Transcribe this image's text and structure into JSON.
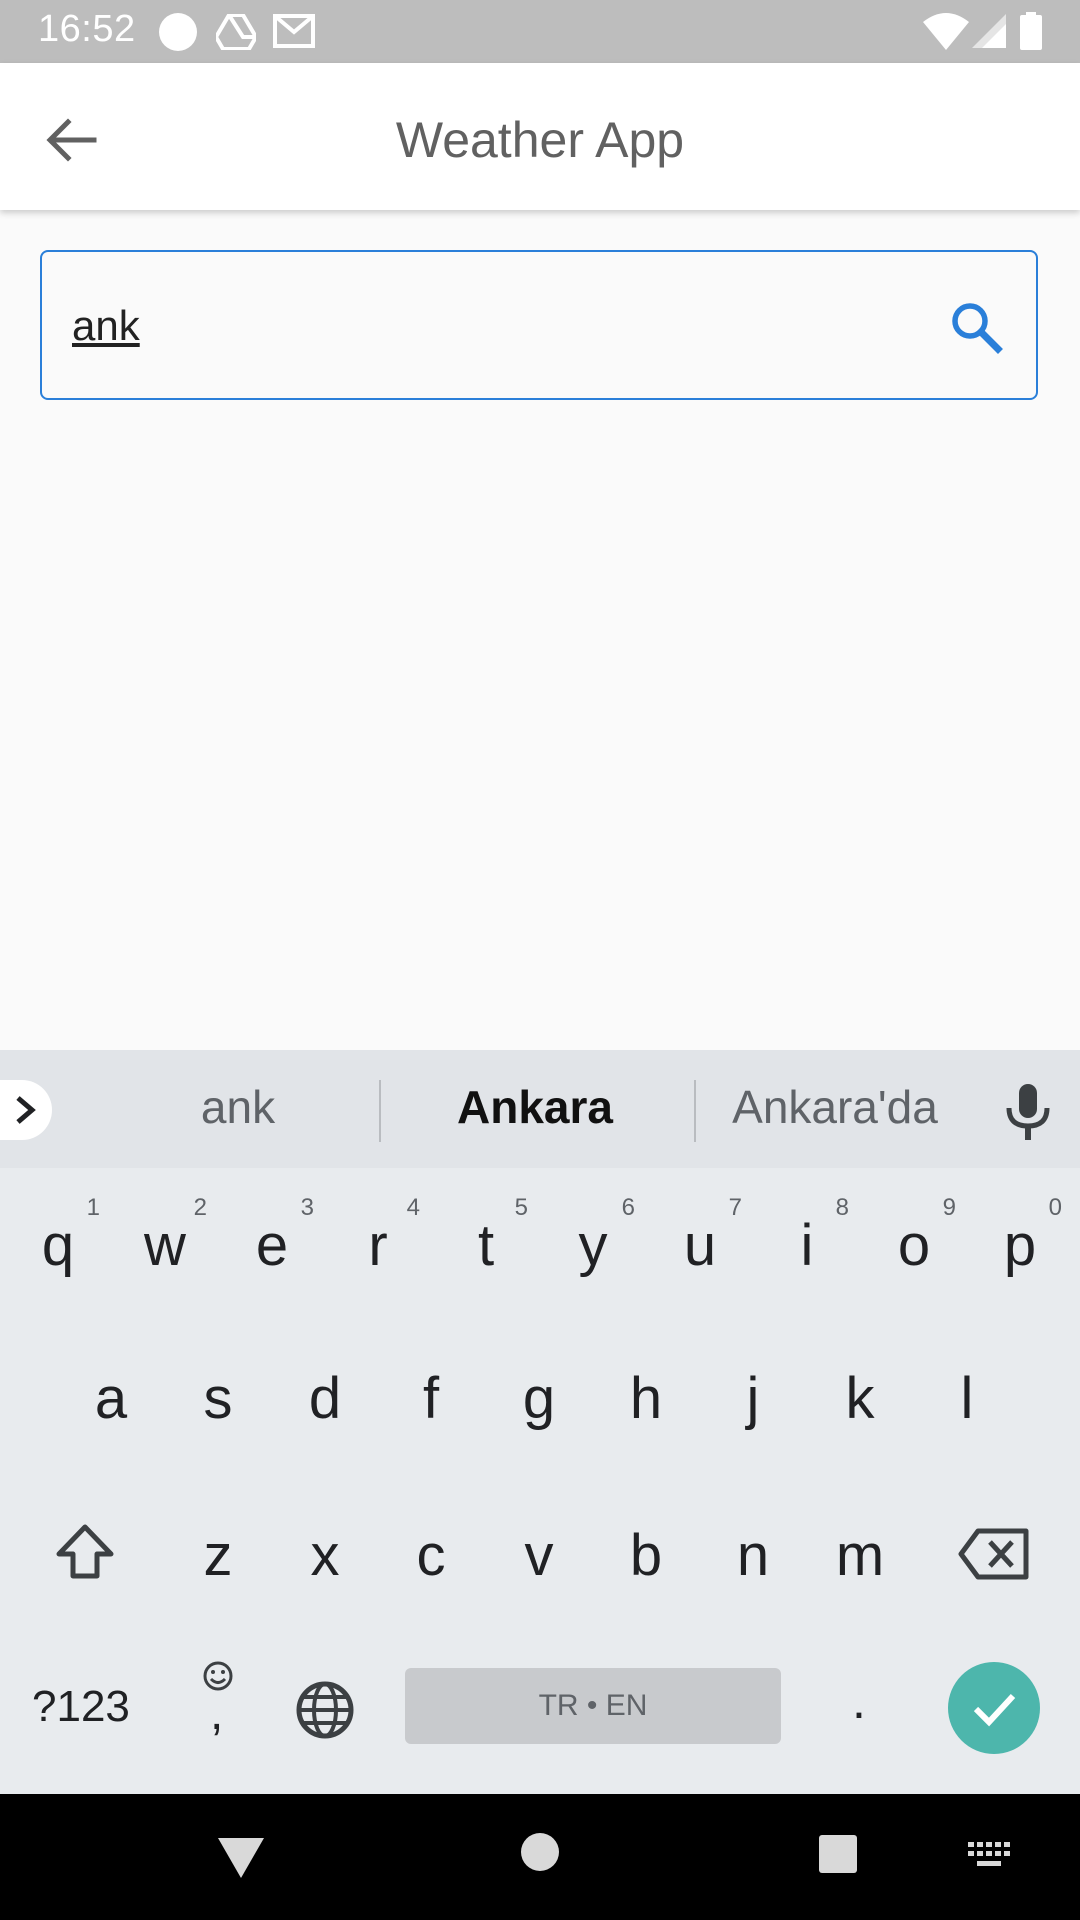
{
  "status_bar": {
    "time": "16:52",
    "icons_left": [
      "circle-icon",
      "drive-icon",
      "gmail-icon"
    ],
    "icons_right": [
      "wifi-icon",
      "signal-icon",
      "battery-icon"
    ]
  },
  "app_bar": {
    "title": "Weather App",
    "back_icon": "arrow-back-icon"
  },
  "search": {
    "value": "ank",
    "icon": "search-icon",
    "border_color": "#2a7fd9"
  },
  "keyboard": {
    "suggestions": [
      "ank",
      "Ankara",
      "Ankara'da"
    ],
    "row1": [
      {
        "key": "q",
        "hint": "1"
      },
      {
        "key": "w",
        "hint": "2"
      },
      {
        "key": "e",
        "hint": "3"
      },
      {
        "key": "r",
        "hint": "4"
      },
      {
        "key": "t",
        "hint": "5"
      },
      {
        "key": "y",
        "hint": "6"
      },
      {
        "key": "u",
        "hint": "7"
      },
      {
        "key": "i",
        "hint": "8"
      },
      {
        "key": "o",
        "hint": "9"
      },
      {
        "key": "p",
        "hint": "0"
      }
    ],
    "row2": [
      "a",
      "s",
      "d",
      "f",
      "g",
      "h",
      "j",
      "k",
      "l"
    ],
    "row3": [
      "z",
      "x",
      "c",
      "v",
      "b",
      "n",
      "m"
    ],
    "symbols_label": "?123",
    "comma_label": ",",
    "period_label": ".",
    "space_label": "TR • EN",
    "enter_color": "#4db6ac"
  },
  "nav_bar": {
    "items": [
      "back-triangle-icon",
      "home-circle-icon",
      "recents-square-icon",
      "keyboard-switch-icon"
    ]
  }
}
